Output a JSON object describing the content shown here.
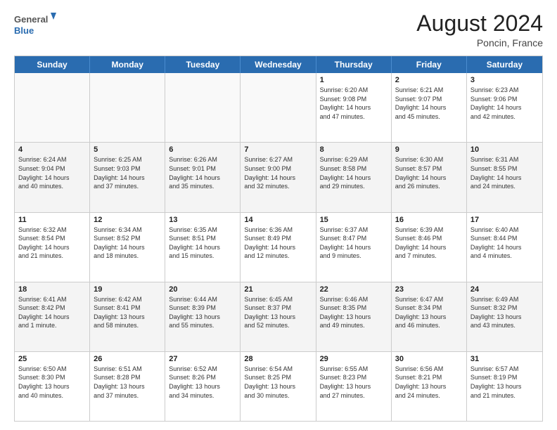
{
  "header": {
    "logo_general": "General",
    "logo_blue": "Blue",
    "month_year": "August 2024",
    "location": "Poncin, France"
  },
  "days_of_week": [
    "Sunday",
    "Monday",
    "Tuesday",
    "Wednesday",
    "Thursday",
    "Friday",
    "Saturday"
  ],
  "weeks": [
    {
      "cells": [
        {
          "day": "",
          "empty": true,
          "text": ""
        },
        {
          "day": "",
          "empty": true,
          "text": ""
        },
        {
          "day": "",
          "empty": true,
          "text": ""
        },
        {
          "day": "",
          "empty": true,
          "text": ""
        },
        {
          "day": "1",
          "empty": false,
          "text": "Sunrise: 6:20 AM\nSunset: 9:08 PM\nDaylight: 14 hours\nand 47 minutes."
        },
        {
          "day": "2",
          "empty": false,
          "text": "Sunrise: 6:21 AM\nSunset: 9:07 PM\nDaylight: 14 hours\nand 45 minutes."
        },
        {
          "day": "3",
          "empty": false,
          "text": "Sunrise: 6:23 AM\nSunset: 9:06 PM\nDaylight: 14 hours\nand 42 minutes."
        }
      ]
    },
    {
      "cells": [
        {
          "day": "4",
          "empty": false,
          "text": "Sunrise: 6:24 AM\nSunset: 9:04 PM\nDaylight: 14 hours\nand 40 minutes."
        },
        {
          "day": "5",
          "empty": false,
          "text": "Sunrise: 6:25 AM\nSunset: 9:03 PM\nDaylight: 14 hours\nand 37 minutes."
        },
        {
          "day": "6",
          "empty": false,
          "text": "Sunrise: 6:26 AM\nSunset: 9:01 PM\nDaylight: 14 hours\nand 35 minutes."
        },
        {
          "day": "7",
          "empty": false,
          "text": "Sunrise: 6:27 AM\nSunset: 9:00 PM\nDaylight: 14 hours\nand 32 minutes."
        },
        {
          "day": "8",
          "empty": false,
          "text": "Sunrise: 6:29 AM\nSunset: 8:58 PM\nDaylight: 14 hours\nand 29 minutes."
        },
        {
          "day": "9",
          "empty": false,
          "text": "Sunrise: 6:30 AM\nSunset: 8:57 PM\nDaylight: 14 hours\nand 26 minutes."
        },
        {
          "day": "10",
          "empty": false,
          "text": "Sunrise: 6:31 AM\nSunset: 8:55 PM\nDaylight: 14 hours\nand 24 minutes."
        }
      ]
    },
    {
      "cells": [
        {
          "day": "11",
          "empty": false,
          "text": "Sunrise: 6:32 AM\nSunset: 8:54 PM\nDaylight: 14 hours\nand 21 minutes."
        },
        {
          "day": "12",
          "empty": false,
          "text": "Sunrise: 6:34 AM\nSunset: 8:52 PM\nDaylight: 14 hours\nand 18 minutes."
        },
        {
          "day": "13",
          "empty": false,
          "text": "Sunrise: 6:35 AM\nSunset: 8:51 PM\nDaylight: 14 hours\nand 15 minutes."
        },
        {
          "day": "14",
          "empty": false,
          "text": "Sunrise: 6:36 AM\nSunset: 8:49 PM\nDaylight: 14 hours\nand 12 minutes."
        },
        {
          "day": "15",
          "empty": false,
          "text": "Sunrise: 6:37 AM\nSunset: 8:47 PM\nDaylight: 14 hours\nand 9 minutes."
        },
        {
          "day": "16",
          "empty": false,
          "text": "Sunrise: 6:39 AM\nSunset: 8:46 PM\nDaylight: 14 hours\nand 7 minutes."
        },
        {
          "day": "17",
          "empty": false,
          "text": "Sunrise: 6:40 AM\nSunset: 8:44 PM\nDaylight: 14 hours\nand 4 minutes."
        }
      ]
    },
    {
      "cells": [
        {
          "day": "18",
          "empty": false,
          "text": "Sunrise: 6:41 AM\nSunset: 8:42 PM\nDaylight: 14 hours\nand 1 minute."
        },
        {
          "day": "19",
          "empty": false,
          "text": "Sunrise: 6:42 AM\nSunset: 8:41 PM\nDaylight: 13 hours\nand 58 minutes."
        },
        {
          "day": "20",
          "empty": false,
          "text": "Sunrise: 6:44 AM\nSunset: 8:39 PM\nDaylight: 13 hours\nand 55 minutes."
        },
        {
          "day": "21",
          "empty": false,
          "text": "Sunrise: 6:45 AM\nSunset: 8:37 PM\nDaylight: 13 hours\nand 52 minutes."
        },
        {
          "day": "22",
          "empty": false,
          "text": "Sunrise: 6:46 AM\nSunset: 8:35 PM\nDaylight: 13 hours\nand 49 minutes."
        },
        {
          "day": "23",
          "empty": false,
          "text": "Sunrise: 6:47 AM\nSunset: 8:34 PM\nDaylight: 13 hours\nand 46 minutes."
        },
        {
          "day": "24",
          "empty": false,
          "text": "Sunrise: 6:49 AM\nSunset: 8:32 PM\nDaylight: 13 hours\nand 43 minutes."
        }
      ]
    },
    {
      "cells": [
        {
          "day": "25",
          "empty": false,
          "text": "Sunrise: 6:50 AM\nSunset: 8:30 PM\nDaylight: 13 hours\nand 40 minutes."
        },
        {
          "day": "26",
          "empty": false,
          "text": "Sunrise: 6:51 AM\nSunset: 8:28 PM\nDaylight: 13 hours\nand 37 minutes."
        },
        {
          "day": "27",
          "empty": false,
          "text": "Sunrise: 6:52 AM\nSunset: 8:26 PM\nDaylight: 13 hours\nand 34 minutes."
        },
        {
          "day": "28",
          "empty": false,
          "text": "Sunrise: 6:54 AM\nSunset: 8:25 PM\nDaylight: 13 hours\nand 30 minutes."
        },
        {
          "day": "29",
          "empty": false,
          "text": "Sunrise: 6:55 AM\nSunset: 8:23 PM\nDaylight: 13 hours\nand 27 minutes."
        },
        {
          "day": "30",
          "empty": false,
          "text": "Sunrise: 6:56 AM\nSunset: 8:21 PM\nDaylight: 13 hours\nand 24 minutes."
        },
        {
          "day": "31",
          "empty": false,
          "text": "Sunrise: 6:57 AM\nSunset: 8:19 PM\nDaylight: 13 hours\nand 21 minutes."
        }
      ]
    }
  ]
}
